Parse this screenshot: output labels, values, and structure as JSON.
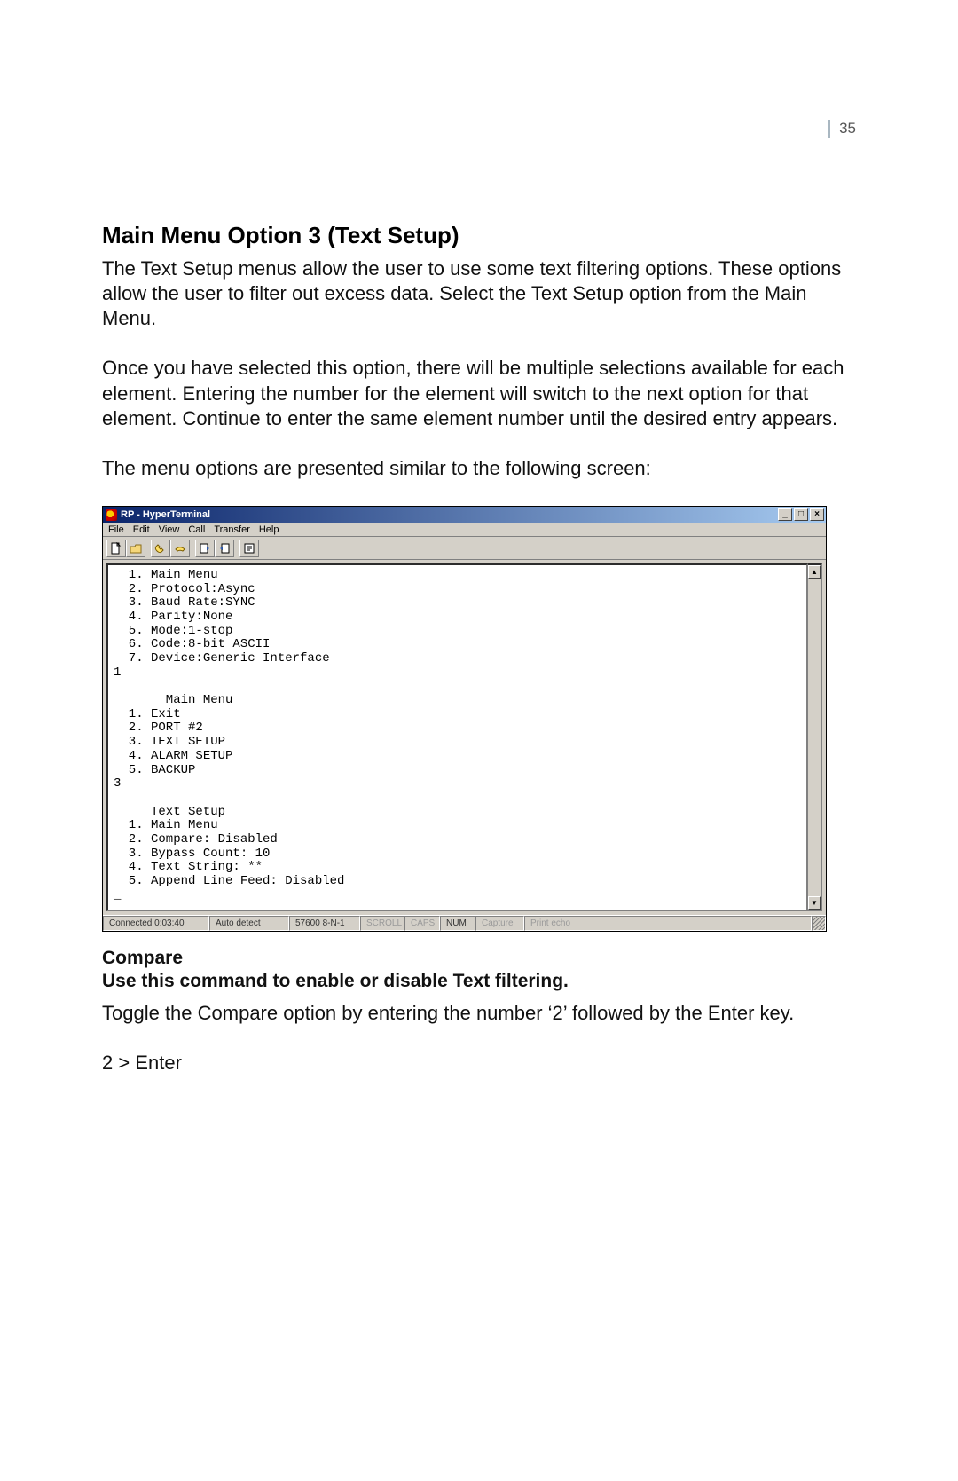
{
  "page_number": "35",
  "section_heading": "Main Menu Option 3 (Text Setup)",
  "para1": "The Text Setup menus allow the user to use some text filtering options. These options allow the user to filter out excess data. Select the Text Setup option from the Main Menu.",
  "para2": "Once you have selected this option, there will be multiple selections available for each element.  Entering the number for the element will switch to the next option for that element. Continue to enter the same element number until the desired entry appears.",
  "para3": "The menu options are presented similar to the following screen:",
  "hyperterminal": {
    "title": "RP - HyperTerminal",
    "menus": [
      "File",
      "Edit",
      "View",
      "Call",
      "Transfer",
      "Help"
    ],
    "window_controls": {
      "minimize": "_",
      "maximize": "□",
      "close": "×"
    },
    "scroll": {
      "up": "▲",
      "down": "▼"
    },
    "terminal_text": "  1. Main Menu\n  2. Protocol:Async\n  3. Baud Rate:SYNC\n  4. Parity:None\n  5. Mode:1-stop\n  6. Code:8-bit ASCII\n  7. Device:Generic Interface\n1\n\n       Main Menu\n  1. Exit\n  2. PORT #2\n  3. TEXT SETUP\n  4. ALARM SETUP\n  5. BACKUP\n3\n\n     Text Setup\n  1. Main Menu\n  2. Compare: Disabled\n  3. Bypass Count: 10\n  4. Text String: **\n  5. Append Line Feed: Disabled\n_",
    "status": {
      "connected": "Connected 0:03:40",
      "detect": "Auto detect",
      "settings": "57600 8-N-1",
      "scroll": "SCROLL",
      "caps": "CAPS",
      "num": "NUM",
      "capture": "Capture",
      "printecho": "Print echo"
    }
  },
  "compare_heading": "Compare",
  "compare_sub": "Use this command to enable or disable Text filtering.",
  "compare_body": "Toggle the Compare option by entering the number ‘2’ followed by the Enter key.",
  "compare_cmd": "2 > Enter"
}
